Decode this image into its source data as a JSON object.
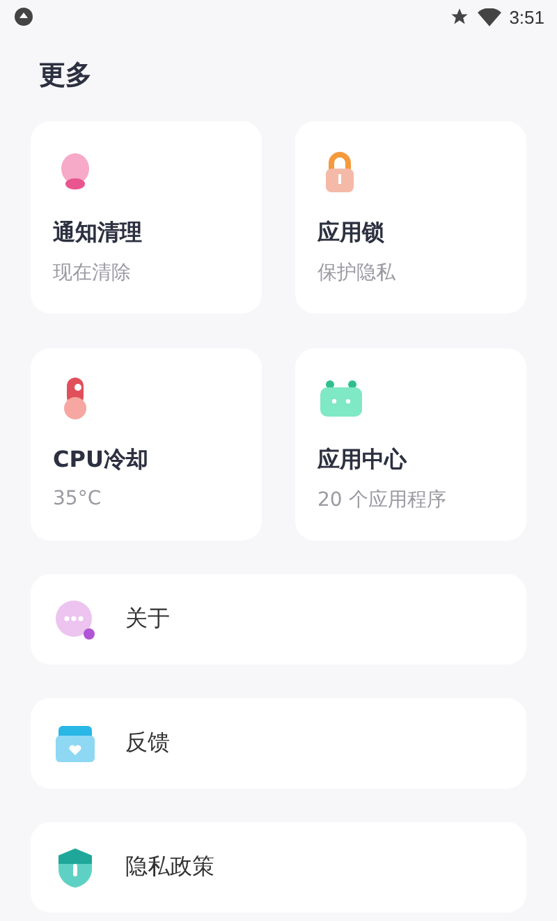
{
  "status_bar": {
    "time": "3:51"
  },
  "title": "更多",
  "cards": [
    {
      "title": "通知清理",
      "subtitle": "现在清除"
    },
    {
      "title": "应用锁",
      "subtitle": "保护隐私"
    },
    {
      "title": "CPU冷却",
      "subtitle": "35°C"
    },
    {
      "title": "应用中心",
      "subtitle": "20 个应用程序"
    }
  ],
  "list_items": [
    {
      "label": "关于"
    },
    {
      "label": "反馈"
    },
    {
      "label": "隐私政策"
    }
  ]
}
